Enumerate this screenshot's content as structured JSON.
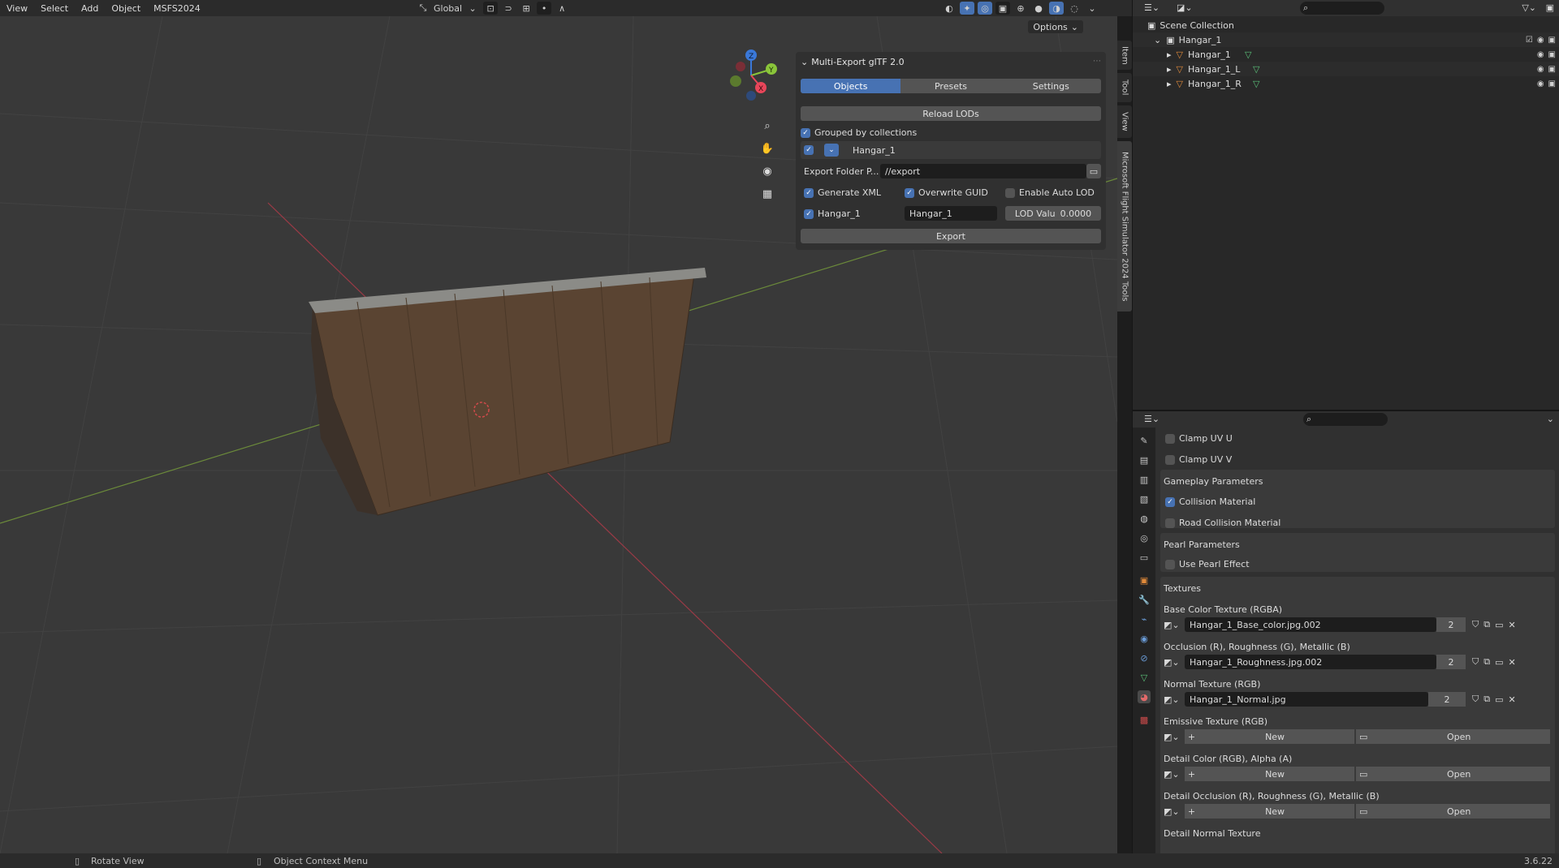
{
  "menu": {
    "items": [
      "View",
      "Select",
      "Add",
      "Object",
      "MSFS2024"
    ]
  },
  "header": {
    "transform_orientation": "Global",
    "options_label": "Options"
  },
  "colors": {
    "accent": "#4772b3",
    "axis_x": "#e8465a",
    "axis_y": "#8ac53a",
    "axis_z": "#3a78d8",
    "wood": "#5a4432"
  },
  "npanel": {
    "title": "Multi-Export glTF 2.0",
    "tabs": [
      {
        "label": "Objects",
        "active": true
      },
      {
        "label": "Presets",
        "active": false
      },
      {
        "label": "Settings",
        "active": false
      }
    ],
    "reload_lods_label": "Reload LODs",
    "grouped_label": "Grouped by collections",
    "grouped_checked": true,
    "collection_name": "Hangar_1",
    "export_folder_label": "Export Folder P...",
    "export_folder_value": "//export",
    "generate_xml_label": "Generate XML",
    "overwrite_guid_label": "Overwrite GUID",
    "enable_auto_lod_label": "Enable Auto LOD",
    "object_label": "Hangar_1",
    "object_name_value": "Hangar_1",
    "lod_value_label": "LOD Valu",
    "lod_value": "0.0000",
    "export_label": "Export"
  },
  "vtabs": [
    "Item",
    "Tool",
    "View",
    "Microsoft Flight Simulator 2024 Tools"
  ],
  "gizmo": {
    "x": "X",
    "y": "Y",
    "z": "Z"
  },
  "outliner": {
    "scene_collection": "Scene Collection",
    "collection": "Hangar_1",
    "objects": [
      "Hangar_1",
      "Hangar_1_L",
      "Hangar_1_R"
    ]
  },
  "properties": {
    "clamp_u": "Clamp UV U",
    "clamp_v": "Clamp UV V",
    "gameplay_header": "Gameplay Parameters",
    "collision_material": "Collision Material",
    "road_collision_material": "Road Collision Material",
    "pearl_header": "Pearl Parameters",
    "use_pearl_effect": "Use Pearl Effect",
    "textures_header": "Textures",
    "textures": [
      {
        "label": "Base Color Texture (RGBA)",
        "file": "Hangar_1_Base_color.jpg.002",
        "users": "2"
      },
      {
        "label": "Occlusion (R), Roughness (G), Metallic (B)",
        "file": "Hangar_1_Roughness.jpg.002",
        "users": "2"
      },
      {
        "label": "Normal Texture (RGB)",
        "file": "Hangar_1_Normal.jpg",
        "users": "2"
      }
    ],
    "empty_textures": [
      "Emissive Texture (RGB)",
      "Detail Color (RGB), Alpha (A)",
      "Detail Occlusion (R), Roughness (G), Metallic (B)"
    ],
    "detail_normal": "Detail Normal Texture",
    "new_label": "New",
    "open_label": "Open"
  },
  "status": {
    "left_action": "Rotate View",
    "mid_action": "Object Context Menu",
    "version": "3.6.22"
  }
}
